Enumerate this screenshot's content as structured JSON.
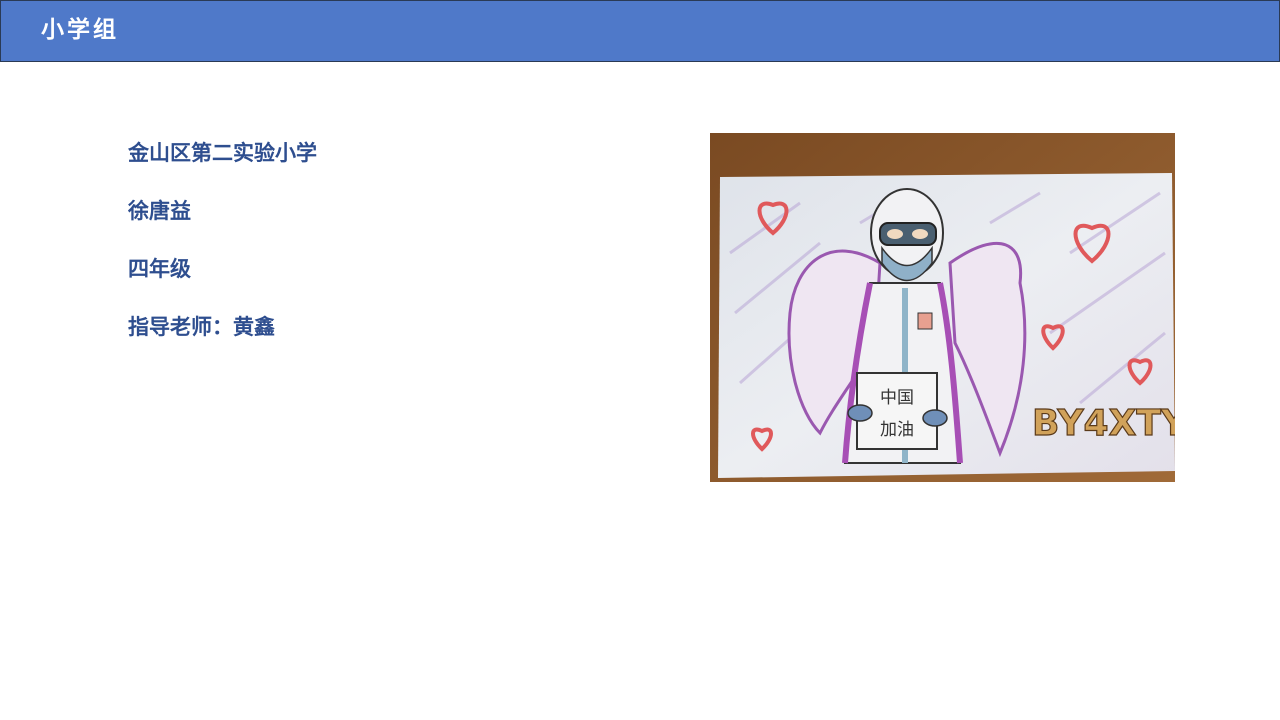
{
  "header": {
    "title": "小学组"
  },
  "info": {
    "school": "金山区第二实验小学",
    "student": "徐唐益",
    "grade": "四年级",
    "teacher": "指导老师：黄鑫"
  },
  "artwork": {
    "sign_line1": "中国",
    "sign_line2": "加油",
    "signature": "BY4XTY",
    "colors": {
      "table": "#8a5a2e",
      "paper": "#e9ecef",
      "suit_accent": "#a74fb5",
      "heart": "#e0595b",
      "signature": "#d1a25a"
    }
  }
}
